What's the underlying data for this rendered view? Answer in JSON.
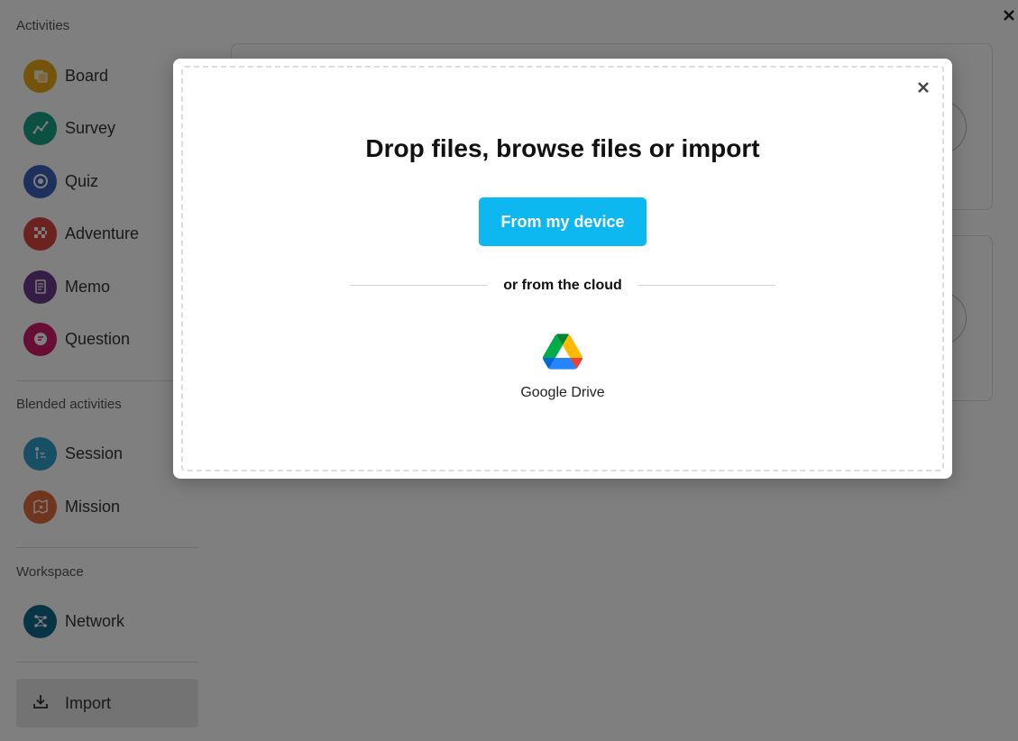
{
  "sidebar": {
    "sections": [
      {
        "title": "Activities"
      },
      {
        "title": "Blended activities"
      },
      {
        "title": "Workspace"
      }
    ],
    "items": [
      {
        "label": "Board",
        "icon": "board-icon",
        "color": "#e8a817"
      },
      {
        "label": "Survey",
        "icon": "survey-icon",
        "color": "#17a085"
      },
      {
        "label": "Quiz",
        "icon": "quiz-icon",
        "color": "#3a63b8"
      },
      {
        "label": "Adventure",
        "icon": "adventure-icon",
        "color": "#d9443f"
      },
      {
        "label": "Memo",
        "icon": "memo-icon",
        "color": "#6b3a8c"
      },
      {
        "label": "Question",
        "icon": "question-icon",
        "color": "#d11d6b"
      },
      {
        "label": "Session",
        "icon": "session-icon",
        "color": "#2e9fc9"
      },
      {
        "label": "Mission",
        "icon": "mission-icon",
        "color": "#e06a3a"
      },
      {
        "label": "Network",
        "icon": "network-icon",
        "color": "#0f6b8c"
      }
    ],
    "import_label": "Import"
  },
  "modal": {
    "title": "Drop files, browse files or import",
    "device_button": "From my device",
    "cloud_text": "or from the cloud",
    "google_drive_label": "Google Drive",
    "accent_color": "#0db7ef"
  }
}
